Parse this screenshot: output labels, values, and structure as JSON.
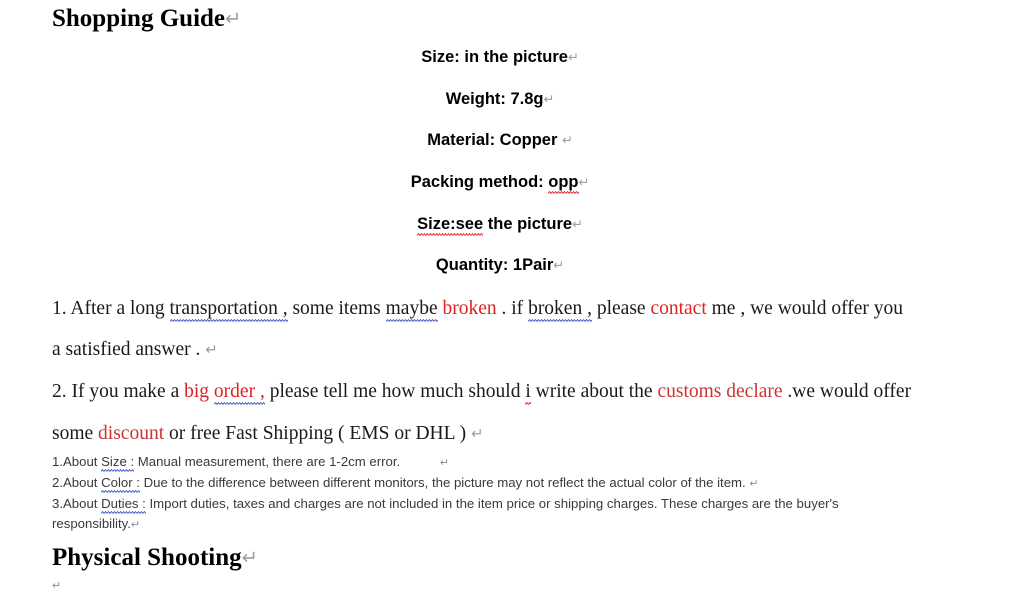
{
  "document": {
    "background_color": "#ffffff",
    "return_mark_glyph": "↵",
    "colors": {
      "body_text": "#1a1a1a",
      "heading": "#000000",
      "accent_red": "#dd2222",
      "spell_underline_red": "#e02020",
      "grammar_underline_blue": "#3a56c8",
      "return_mark": "#9aa0a6"
    },
    "headings": [
      {
        "id": "shopping-guide",
        "text": "Shopping Guide"
      },
      {
        "id": "physical-shooting",
        "text": "Physical Shooting"
      }
    ],
    "spec_lines": [
      {
        "id": "size",
        "text": "Size: in the picture"
      },
      {
        "id": "weight",
        "text": "Weight: 7.8g"
      },
      {
        "id": "material",
        "text": "Material: Copper "
      },
      {
        "id": "packing",
        "pre": "Packing method: ",
        "marked": "opp",
        "mark": "spell-red"
      },
      {
        "id": "size-see",
        "marked": "Size:see",
        "post": " the picture",
        "mark": "spell-red"
      },
      {
        "id": "quantity",
        "text": "Quantity: 1Pair"
      }
    ],
    "paragraphs": {
      "p1_line1": {
        "segments": [
          {
            "t": "1. After a long ",
            "style": "plain"
          },
          {
            "t": "transportation ,",
            "style": "grammar-blue"
          },
          {
            "t": " some items ",
            "style": "plain"
          },
          {
            "t": "maybe",
            "style": "grammar-blue"
          },
          {
            "t": " ",
            "style": "plain"
          },
          {
            "t": "broken",
            "style": "red"
          },
          {
            "t": " . if ",
            "style": "plain"
          },
          {
            "t": "broken ,",
            "style": "grammar-blue"
          },
          {
            "t": " please ",
            "style": "plain"
          },
          {
            "t": "contact",
            "style": "red"
          },
          {
            "t": " me , we would offer you",
            "style": "plain"
          }
        ]
      },
      "p1_line2": {
        "segments": [
          {
            "t": "a satisfied answer .",
            "style": "plain"
          }
        ]
      },
      "p2_line1": {
        "segments": [
          {
            "t": "2. If you make a ",
            "style": "plain"
          },
          {
            "t": "big ",
            "style": "red"
          },
          {
            "t": "order ,",
            "style": "red-grammar-blue"
          },
          {
            "t": " please tell me how much should ",
            "style": "plain"
          },
          {
            "t": "i",
            "style": "spell-red"
          },
          {
            "t": " write about the ",
            "style": "plain"
          },
          {
            "t": "customs declare",
            "style": "red-soft"
          },
          {
            "t": " .we would offer",
            "style": "plain"
          }
        ]
      },
      "p2_line2": {
        "segments": [
          {
            "t": "some ",
            "style": "plain"
          },
          {
            "t": "discount",
            "style": "red-soft"
          },
          {
            "t": " or free Fast Shipping ( EMS or DHL ) ",
            "style": "plain"
          }
        ]
      }
    },
    "notes": [
      {
        "id": "note-size",
        "segments": [
          {
            "t": "1.About ",
            "style": "plain"
          },
          {
            "t": "Size :",
            "style": "grammar-blue"
          },
          {
            "t": " Manual measurement, there are 1-2cm error.",
            "style": "plain"
          }
        ],
        "trailing_mark": true
      },
      {
        "id": "note-color",
        "segments": [
          {
            "t": "2.About ",
            "style": "plain"
          },
          {
            "t": "Color :",
            "style": "grammar-blue"
          },
          {
            "t": " Due to the difference between different monitors, the picture may not reflect the actual color of the item. ",
            "style": "plain"
          }
        ],
        "trailing_mark": true
      },
      {
        "id": "note-duties",
        "segments": [
          {
            "t": "3.About ",
            "style": "plain"
          },
          {
            "t": "Duties :",
            "style": "grammar-blue"
          },
          {
            "t": " Import duties, taxes and charges are not included in the item price or shipping charges. These charges are the buyer's responsibility.",
            "style": "plain"
          }
        ],
        "trailing_mark": true
      }
    ],
    "trailing_empty_paragraph_mark": "↵"
  }
}
